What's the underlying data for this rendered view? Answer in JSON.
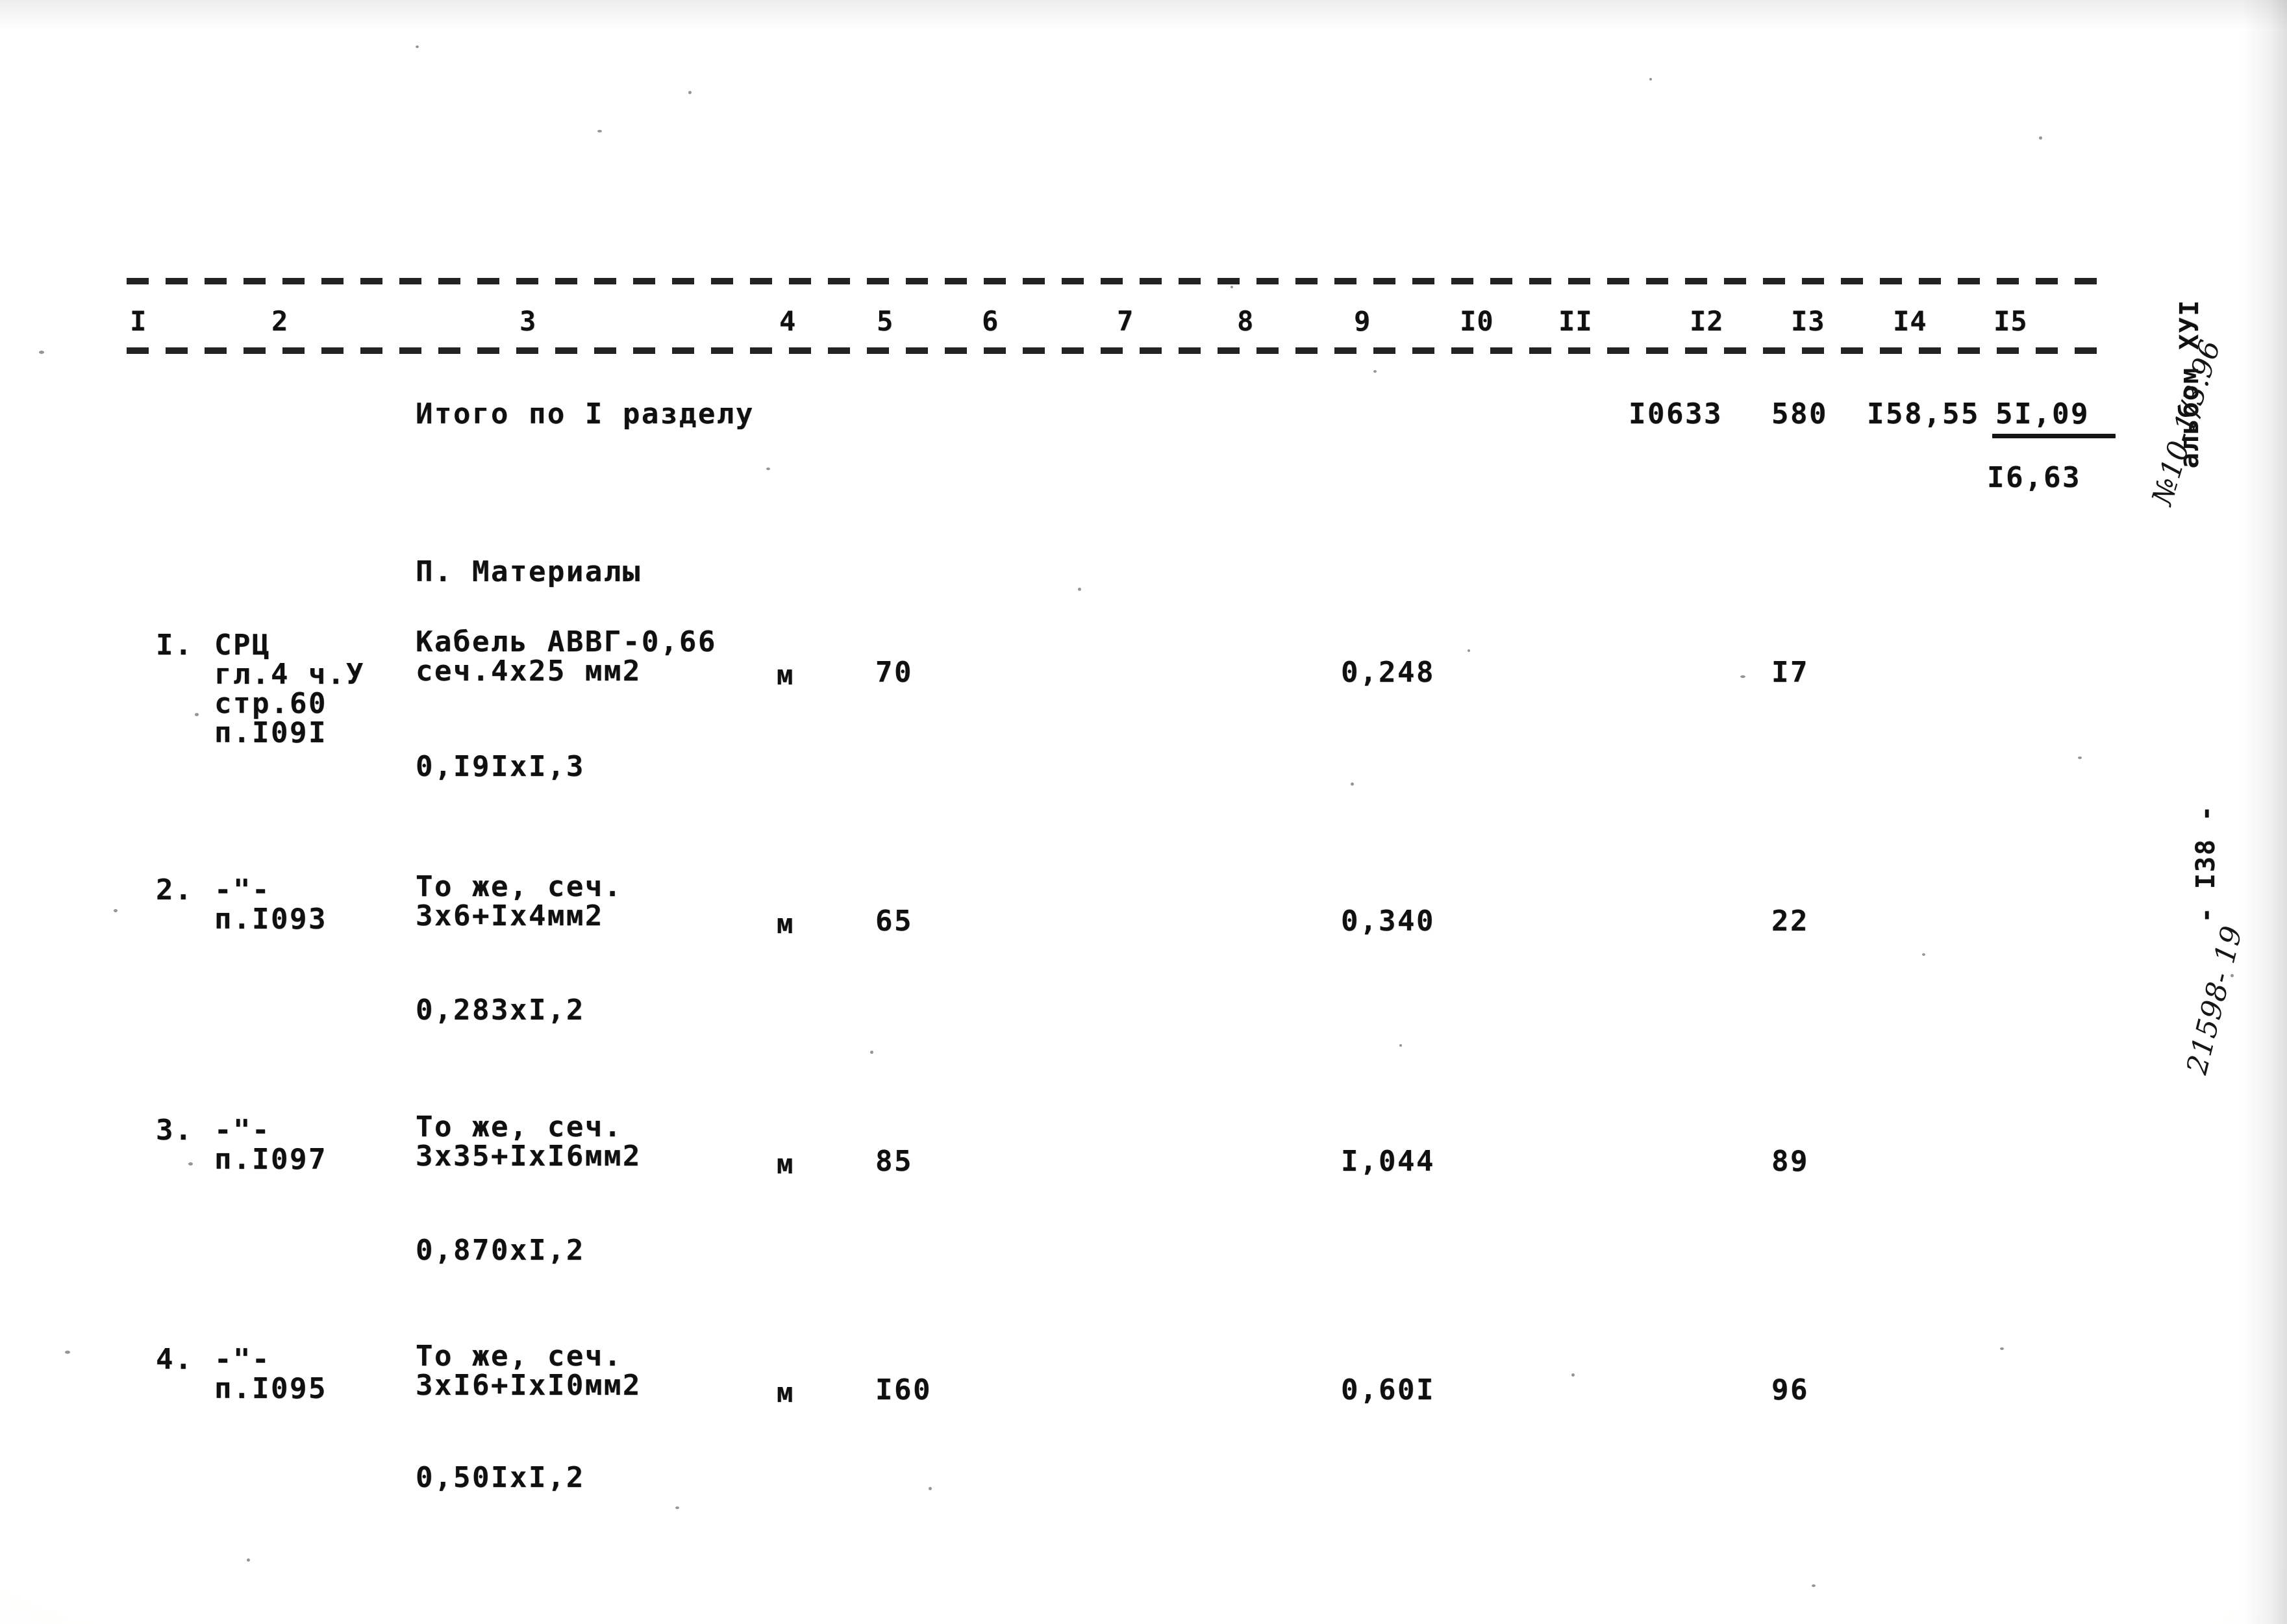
{
  "document": {
    "type": "soviet-construction-estimate-sheet",
    "page_number": "- I38 -",
    "album_label": "альбом ХУI",
    "album_handwritten": "№10-1/3.96",
    "archive_handwritten": "21598- 19"
  },
  "table": {
    "column_numbers": [
      "I",
      "2",
      "3",
      "4",
      "5",
      "6",
      "7",
      "8",
      "9",
      "I0",
      "II",
      "I2",
      "I3",
      "I4",
      "I5"
    ],
    "summary_row": {
      "label": "Итого по I разделу",
      "col12": "I0633",
      "col13": "580",
      "col14": "I58,55",
      "col15": "5I,09",
      "col15_second": "I6,63"
    },
    "section_heading": "П. Материалы",
    "rows": [
      {
        "num": "I.",
        "source_lines": [
          "СРЦ",
          "гл.4 ч.У",
          "стр.60",
          "п.I09I"
        ],
        "desc_lines": [
          "Кабель АВВГ-0,66",
          "сеч.4х25 мм2"
        ],
        "unit": "м",
        "qty": "70",
        "col9": "0,248",
        "col13": "I7",
        "calc": "0,I9IxI,3"
      },
      {
        "num": "2.",
        "source_lines": [
          "-\"-",
          "п.I093"
        ],
        "desc_lines": [
          "То же, сеч.",
          "3х6+Iх4мм2"
        ],
        "unit": "м",
        "qty": "65",
        "col9": "0,340",
        "col13": "22",
        "calc": "0,283хI,2"
      },
      {
        "num": "3.",
        "source_lines": [
          "-\"-",
          "п.I097"
        ],
        "desc_lines": [
          "То же, сеч.",
          "3х35+IхI6мм2"
        ],
        "unit": "м",
        "qty": "85",
        "col9": "I,044",
        "col13": "89",
        "calc": "0,870хI,2"
      },
      {
        "num": "4.",
        "source_lines": [
          "-\"-",
          "п.I095"
        ],
        "desc_lines": [
          "То же, сеч.",
          "3хI6+IхI0мм2"
        ],
        "unit": "м",
        "qty": "I60",
        "col9": "0,60I",
        "col13": "96",
        "calc": "0,50IxI,2"
      }
    ]
  }
}
